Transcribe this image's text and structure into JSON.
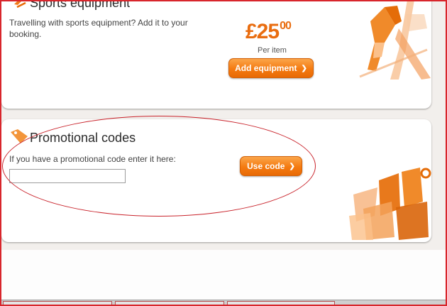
{
  "sports": {
    "title": "Sports equipment",
    "description": "Travelling with sports equipment? Add it to your booking.",
    "price_main": "£25",
    "price_pence": "00",
    "per_item": "Per item",
    "button_label": "Add equipment"
  },
  "promo": {
    "title": "Promotional codes",
    "prompt": "If you have a promotional code enter it here:",
    "input_value": "",
    "button_label": "Use code"
  },
  "colors": {
    "accent": "#f47a10",
    "annotation": "#c9242c",
    "frame": "#d8262c"
  },
  "icons": [
    "sports-equipment-icon",
    "tag-icon",
    "chevron-right-icon",
    "ski-equipment-illustration",
    "discount-numbers-illustration"
  ]
}
